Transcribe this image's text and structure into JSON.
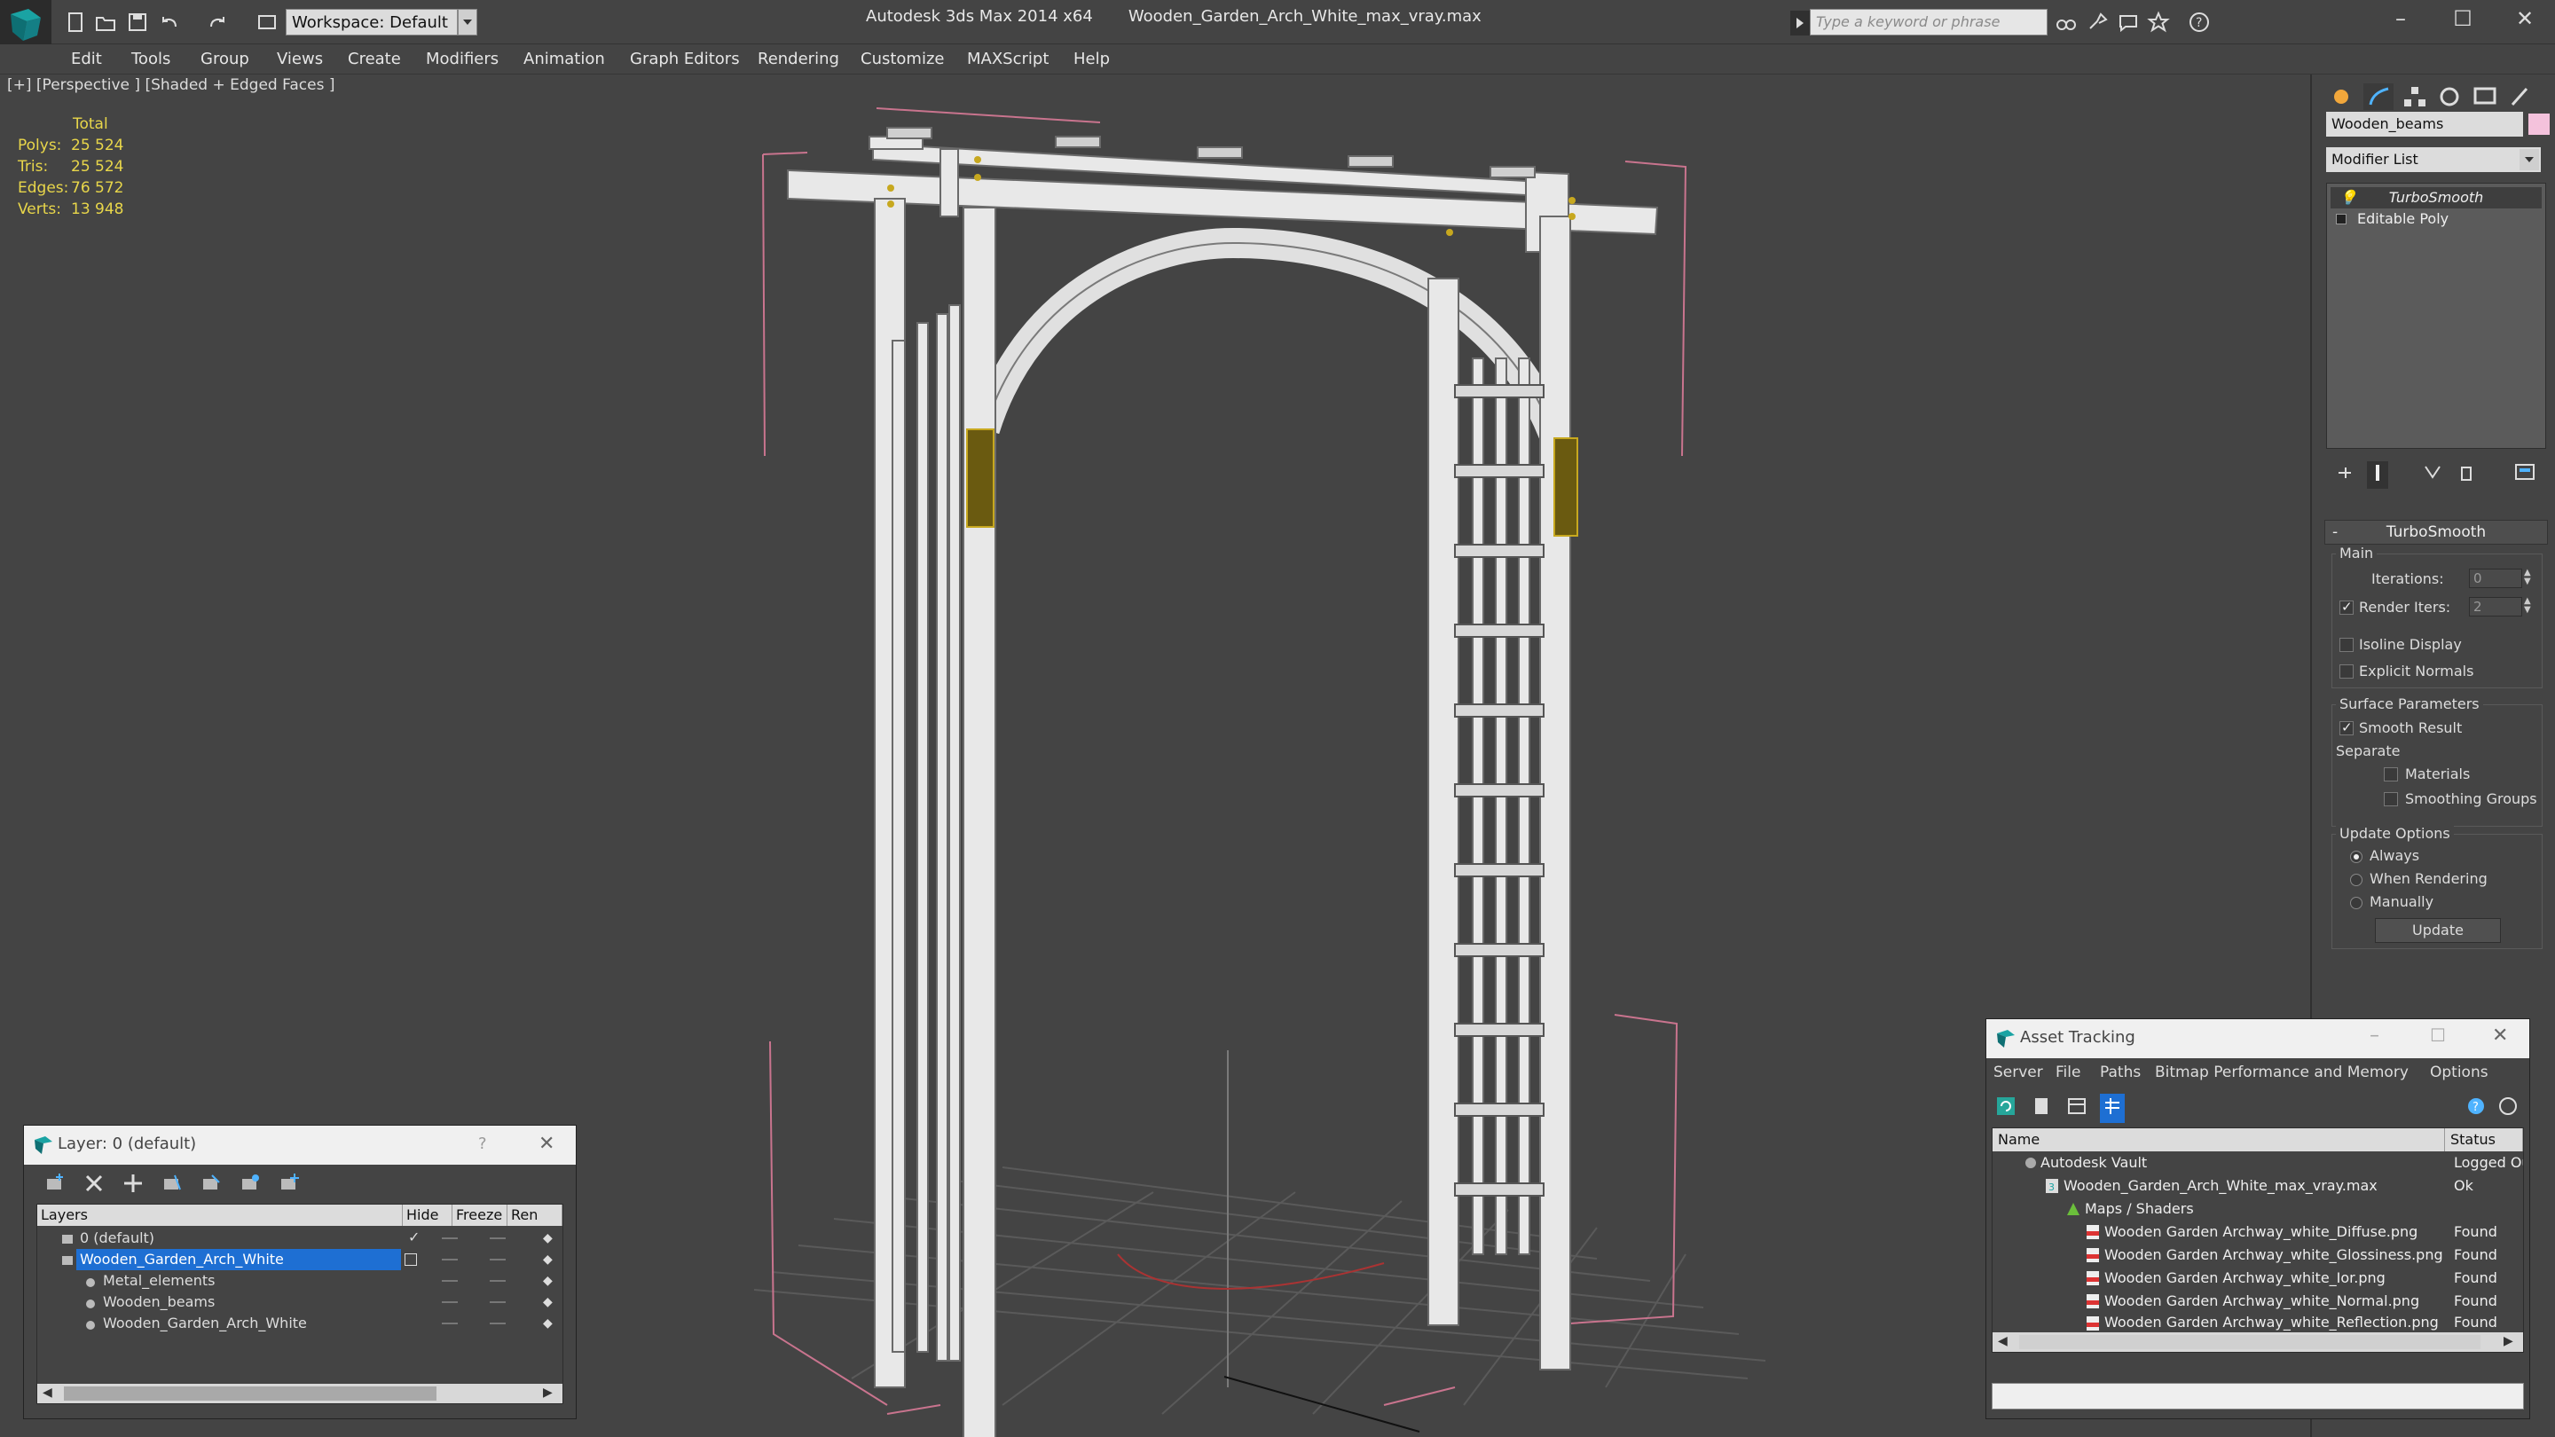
{
  "titlebar": {
    "workspace": "Workspace: Default",
    "app_title": "Autodesk 3ds Max  2014 x64",
    "file_title": "Wooden_Garden_Arch_White_max_vray.max",
    "search_placeholder": "Type a keyword or phrase"
  },
  "menu": [
    "Edit",
    "Tools",
    "Group",
    "Views",
    "Create",
    "Modifiers",
    "Animation",
    "Graph Editors",
    "Rendering",
    "Customize",
    "MAXScript",
    "Help"
  ],
  "viewport": {
    "label": "[+] [Perspective ] [Shaded + Edged Faces ]",
    "stats_header": "Total",
    "stats": [
      {
        "key": "Polys:",
        "value": "25 524"
      },
      {
        "key": "Tris:",
        "value": "25 524"
      },
      {
        "key": "Edges:",
        "value": "76 572"
      },
      {
        "key": "Verts:",
        "value": "13 948"
      }
    ]
  },
  "command_panel": {
    "object_name": "Wooden_beams",
    "modifier_list": "Modifier List",
    "stack": [
      "TurboSmooth",
      "Editable Poly"
    ],
    "rollout_title": "TurboSmooth",
    "main_label": "Main",
    "iterations_label": "Iterations:",
    "iterations_value": "0",
    "render_iters_label": "Render Iters:",
    "render_iters_value": "2",
    "isoline_label": "Isoline Display",
    "explicit_normals_label": "Explicit Normals",
    "surface_params_label": "Surface Parameters",
    "smooth_result_label": "Smooth Result",
    "separate_label": "Separate",
    "materials_label": "Materials",
    "smoothing_groups_label": "Smoothing Groups",
    "update_options_label": "Update Options",
    "always_label": "Always",
    "when_rendering_label": "When Rendering",
    "manually_label": "Manually",
    "update_button": "Update",
    "accent_color": "#f4c2dc"
  },
  "layer_dialog": {
    "title": "Layer: 0 (default)",
    "help": "?",
    "columns": [
      "Layers",
      "Hide",
      "Freeze",
      "Ren"
    ],
    "rows": [
      {
        "name": "0 (default)",
        "level": 0,
        "selected": false
      },
      {
        "name": "Wooden_Garden_Arch_White",
        "level": 0,
        "selected": true
      },
      {
        "name": "Metal_elements",
        "level": 1,
        "selected": false
      },
      {
        "name": "Wooden_beams",
        "level": 1,
        "selected": false
      },
      {
        "name": "Wooden_Garden_Arch_White",
        "level": 1,
        "selected": false
      }
    ]
  },
  "asset_dialog": {
    "title": "Asset Tracking",
    "menu": [
      "Server",
      "File",
      "Paths",
      "Bitmap Performance and Memory",
      "Options"
    ],
    "columns": [
      "Name",
      "Status"
    ],
    "rows": [
      {
        "name": "Autodesk Vault",
        "status": "Logged Ou",
        "level": 0
      },
      {
        "name": "Wooden_Garden_Arch_White_max_vray.max",
        "status": "Ok",
        "level": 1
      },
      {
        "name": "Maps / Shaders",
        "status": "",
        "level": 2
      },
      {
        "name": "Wooden Garden Archway_white_Diffuse.png",
        "status": "Found",
        "level": 3
      },
      {
        "name": "Wooden Garden Archway_white_Glossiness.png",
        "status": "Found",
        "level": 3
      },
      {
        "name": "Wooden Garden Archway_white_Ior.png",
        "status": "Found",
        "level": 3
      },
      {
        "name": "Wooden Garden Archway_white_Normal.png",
        "status": "Found",
        "level": 3
      },
      {
        "name": "Wooden Garden Archway_white_Reflection.png",
        "status": "Found",
        "level": 3
      }
    ]
  }
}
